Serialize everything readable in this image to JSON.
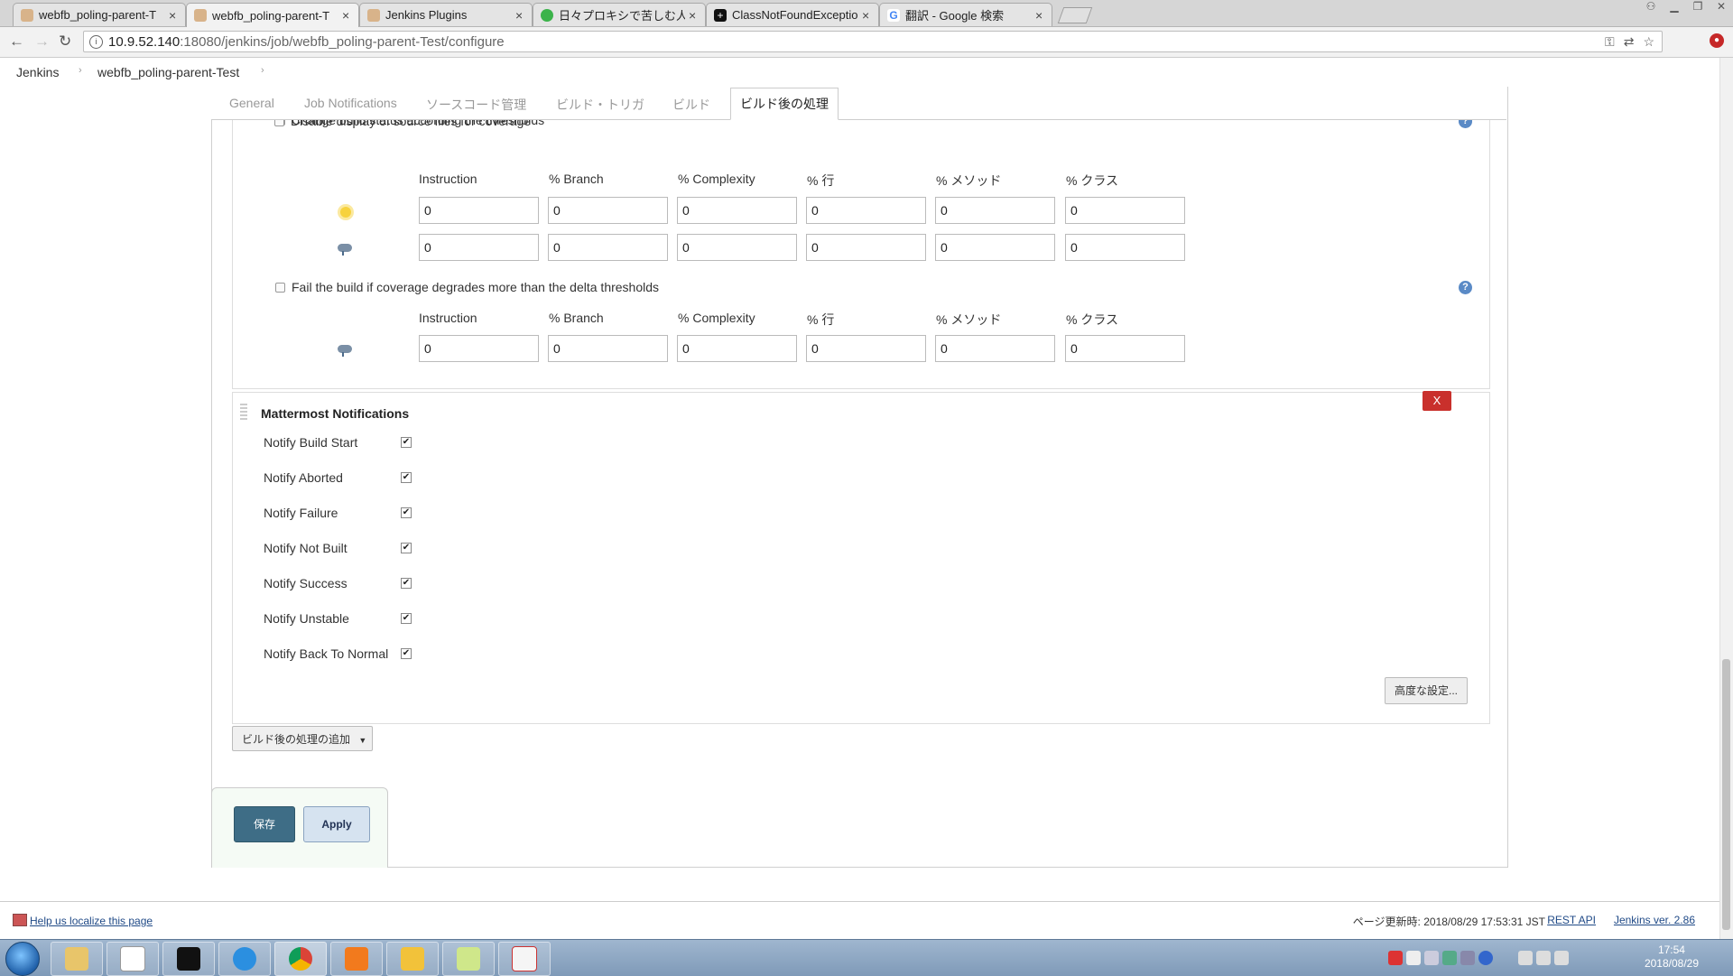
{
  "browser": {
    "tabs": [
      {
        "label": "webfb_poling-parent-T",
        "icon": "jenkins-favicon",
        "active": false
      },
      {
        "label": "webfb_poling-parent-T",
        "icon": "jenkins-favicon",
        "active": true
      },
      {
        "label": "Jenkins Plugins",
        "icon": "jenkins-favicon",
        "active": false
      },
      {
        "label": "日々プロキシで苦しむ人",
        "icon": "green-favicon",
        "active": false
      },
      {
        "label": "ClassNotFoundExceptio",
        "icon": "plus-favicon",
        "active": false
      },
      {
        "label": "翻訳 - Google 検索",
        "icon": "google-favicon",
        "active": false
      }
    ],
    "url_host": "10.9.52.140",
    "url_rest": ":18080/jenkins/job/webfb_poling-parent-Test/configure"
  },
  "breadcrumb": {
    "home": "Jenkins",
    "job": "webfb_poling-parent-Test"
  },
  "config_tabs": [
    "General",
    "Job Notifications",
    "ソースコード管理",
    "ビルド・トリガ",
    "ビルド",
    "ビルド後の処理"
  ],
  "coverage": {
    "partial_label": "Disable display of source files for coverage",
    "change_status_label": "Change build status according the thresholds",
    "fail_delta_label": "Fail the build if coverage degrades more than the delta thresholds",
    "columns": [
      "Instruction",
      "% Branch",
      "% Complexity",
      "% 行",
      "% メソッド",
      "% クラス"
    ],
    "healthy_values": [
      "0",
      "0",
      "0",
      "0",
      "0",
      "0"
    ],
    "unhealthy_values": [
      "0",
      "0",
      "0",
      "0",
      "0",
      "0"
    ],
    "delta_values": [
      "0",
      "0",
      "0",
      "0",
      "0",
      "0"
    ],
    "help_glyph": "?"
  },
  "mattermost": {
    "title": "Mattermost Notifications",
    "delete_label": "X",
    "options": [
      {
        "label": "Notify Build Start",
        "checked": true
      },
      {
        "label": "Notify Aborted",
        "checked": true
      },
      {
        "label": "Notify Failure",
        "checked": true
      },
      {
        "label": "Notify Not Built",
        "checked": true
      },
      {
        "label": "Notify Success",
        "checked": true
      },
      {
        "label": "Notify Unstable",
        "checked": true
      },
      {
        "label": "Notify Back To Normal",
        "checked": true
      }
    ],
    "advanced_label": "高度な設定..."
  },
  "add_post_build_label": "ビルド後の処理の追加",
  "save_label": "保存",
  "apply_label": "Apply",
  "footer": {
    "localize": "Help us localize this page",
    "updated": "ページ更新時: 2018/08/29 17:53:31 JST",
    "rest_api": "REST API",
    "version": "Jenkins ver. 2.86"
  },
  "taskbar": {
    "time": "17:54",
    "date": "2018/08/29"
  }
}
